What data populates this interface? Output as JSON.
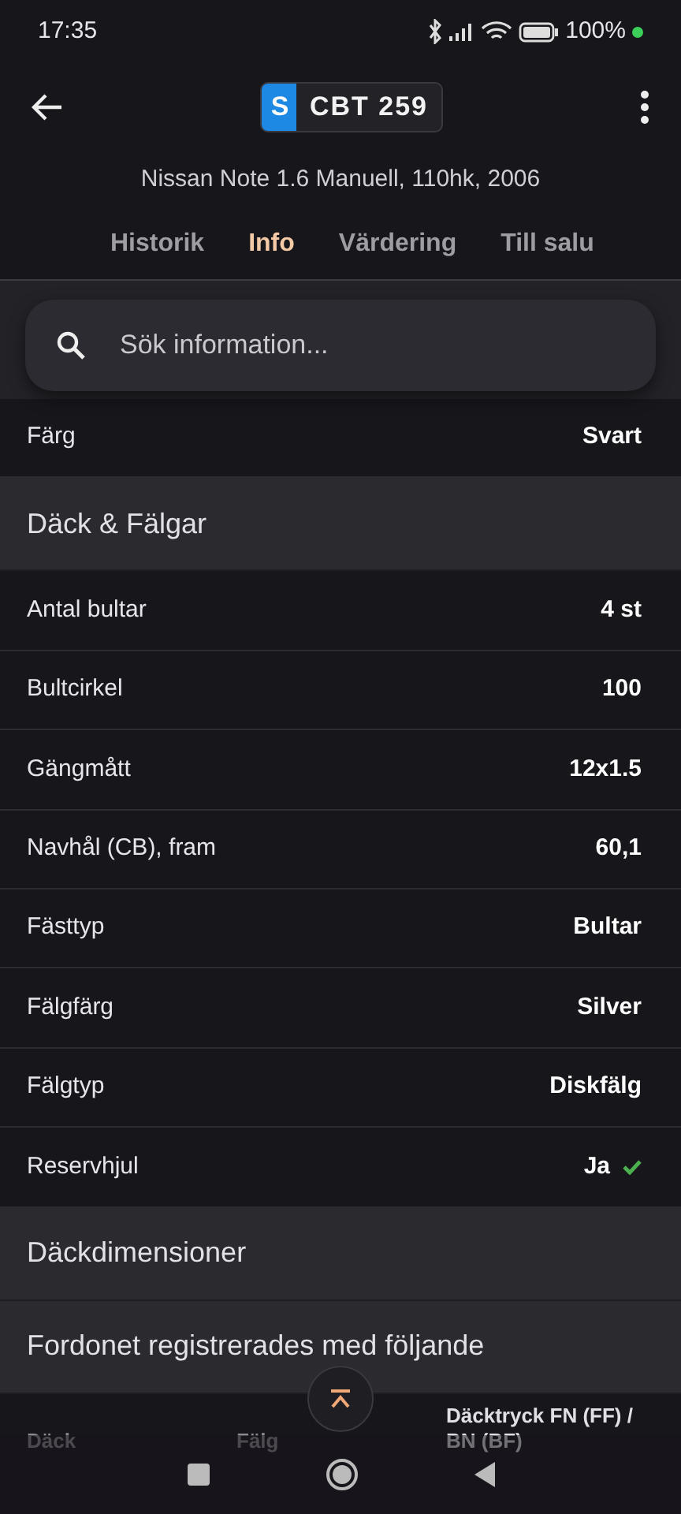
{
  "status_bar": {
    "time": "17:35",
    "battery": "100%"
  },
  "app_bar": {
    "plate_country": "S",
    "plate": "CBT 259",
    "subtitle": "Nissan Note 1.6 Manuell, 110hk, 2006"
  },
  "tabs": [
    {
      "label": "Historik",
      "selected": false
    },
    {
      "label": "Info",
      "selected": true
    },
    {
      "label": "Värdering",
      "selected": false
    },
    {
      "label": "Till salu",
      "selected": false
    }
  ],
  "search": {
    "placeholder": "Sök information..."
  },
  "rows": [
    {
      "kind": "row",
      "label": "Färg",
      "value": "Svart",
      "checked": false
    },
    {
      "kind": "section",
      "label": "Däck & Fälgar"
    },
    {
      "kind": "row",
      "label": "Antal bultar",
      "value": "4 st",
      "checked": false
    },
    {
      "kind": "row",
      "label": "Bultcirkel",
      "value": "100",
      "checked": false
    },
    {
      "kind": "row",
      "label": "Gängmått",
      "value": "12x1.5",
      "checked": false
    },
    {
      "kind": "row",
      "label": "Navhål (CB), fram",
      "value": "60,1",
      "checked": false
    },
    {
      "kind": "row",
      "label": "Fästtyp",
      "value": "Bultar",
      "checked": false
    },
    {
      "kind": "row",
      "label": "Fälgfärg",
      "value": "Silver",
      "checked": false
    },
    {
      "kind": "row",
      "label": "Fälgtyp",
      "value": "Diskfälg",
      "checked": false
    },
    {
      "kind": "row",
      "label": "Reservhjul",
      "value": "Ja",
      "checked": true
    },
    {
      "kind": "section",
      "label": "Däckdimensioner"
    },
    {
      "kind": "section",
      "label": "Fordonet registrerades med följande"
    }
  ],
  "table": {
    "columns": [
      "Däck",
      "Fälg",
      "Däcktryck FN (FF) / BN (BF)"
    ]
  }
}
